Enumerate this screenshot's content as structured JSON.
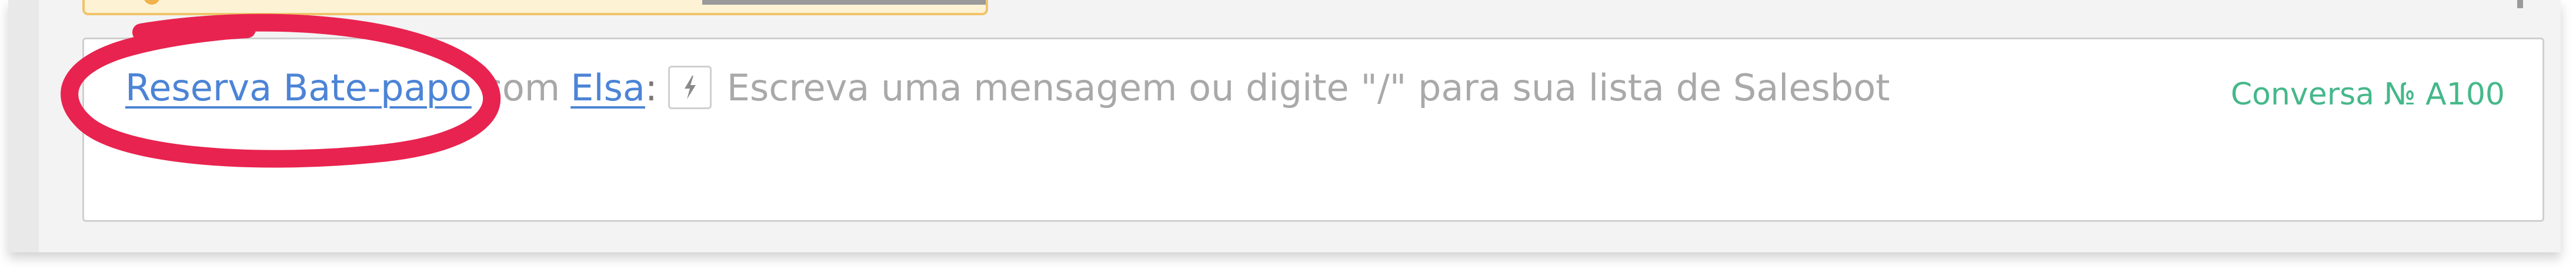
{
  "composer": {
    "channel_link": "Reserva Bate-papo",
    "connector": "com",
    "contact_link": "Elsa",
    "separator": ":",
    "placeholder": "Escreva uma mensagem ou digite \"/\" para sua lista de Salesbot",
    "bolt_icon": "bolt-icon"
  },
  "conversation": {
    "id_label": "Conversa № A100"
  },
  "colors": {
    "link": "#4c84d6",
    "conversation_id": "#45b88a",
    "annotation": "#e8234f",
    "warning_border": "#f0c46a",
    "warning_bg": "#fdf3d4"
  }
}
